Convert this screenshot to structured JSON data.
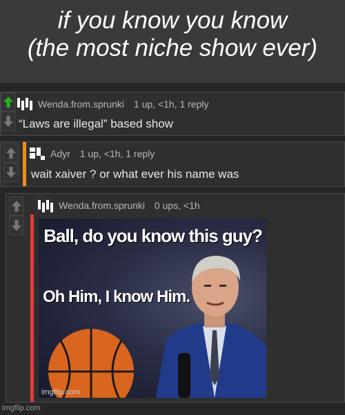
{
  "caption": {
    "line1": "if you know you know",
    "line2": "(the most niche show ever)"
  },
  "comments": [
    {
      "username": "Wenda.from.sprunki",
      "stats": "1 up, <1h, 1 reply",
      "text": "“Laws are illegal” based show",
      "upvoted": true,
      "accent_color": "#27b11d"
    },
    {
      "username": "Adyr",
      "stats": "1 up, <1h, 1 reply",
      "text": "wait xaiver ? or what ever his name was",
      "accent_color": "#f08c1b"
    },
    {
      "username": "Wenda.from.sprunki",
      "stats": "0 ups, <1h",
      "accent_color": "#e23c3c",
      "meme": {
        "text_top": "Ball, do you know this guy?",
        "text_mid": "Oh Him, I know Him.",
        "watermark": "imgflip.com"
      }
    }
  ],
  "footer": {
    "watermark": "imgflip.com"
  },
  "icons": {
    "upvote": "arrow-up-icon",
    "downvote": "arrow-down-icon"
  }
}
